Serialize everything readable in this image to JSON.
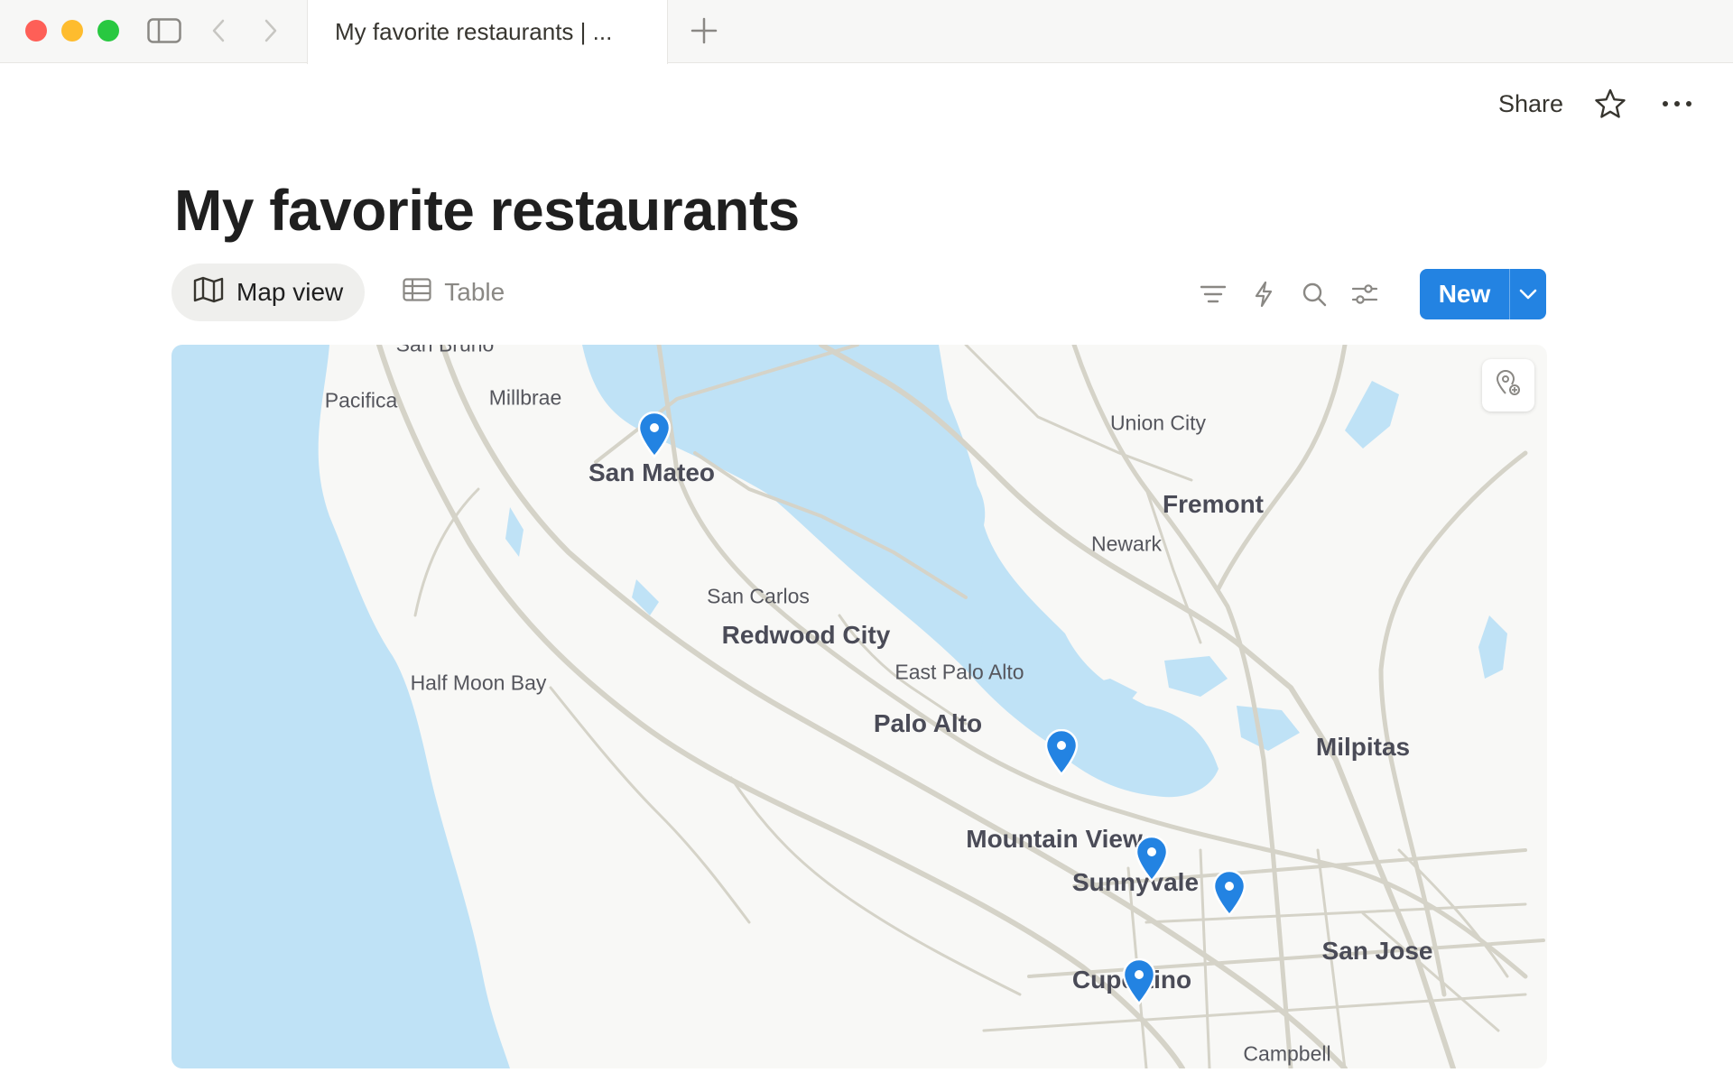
{
  "browser": {
    "tab_title": "My favorite restaurants | ...",
    "icons": [
      "sidebar-icon",
      "back-arrow-icon",
      "forward-arrow-icon",
      "plus-icon"
    ]
  },
  "header": {
    "share_label": "Share",
    "icons": [
      "star-icon",
      "more-icon"
    ]
  },
  "page": {
    "title": "My favorite restaurants"
  },
  "views": [
    {
      "label": "Map view",
      "icon": "map-icon",
      "active": true
    },
    {
      "label": "Table",
      "icon": "table-icon",
      "active": false
    }
  ],
  "toolbar": {
    "icons": [
      "filter-icon",
      "lightning-icon",
      "search-icon",
      "settings-sliders-icon"
    ],
    "new_label": "New",
    "accent": "#2383e2"
  },
  "map": {
    "water_color": "#bfe2f6",
    "land_color": "#f8f8f6",
    "road_color": "#d5d3c8",
    "pin_color": "#2383e2",
    "places": [
      {
        "name": "San Bruno",
        "major": false
      },
      {
        "name": "Pacifica",
        "major": false
      },
      {
        "name": "Millbrae",
        "major": false
      },
      {
        "name": "San Mateo",
        "major": true
      },
      {
        "name": "Union City",
        "major": false
      },
      {
        "name": "Fremont",
        "major": true
      },
      {
        "name": "Newark",
        "major": false
      },
      {
        "name": "San Carlos",
        "major": false
      },
      {
        "name": "Redwood City",
        "major": true
      },
      {
        "name": "East Palo Alto",
        "major": false
      },
      {
        "name": "Half Moon Bay",
        "major": false
      },
      {
        "name": "Palo Alto",
        "major": true
      },
      {
        "name": "Milpitas",
        "major": true
      },
      {
        "name": "Mountain View",
        "major": true
      },
      {
        "name": "Sunnyvale",
        "major": true
      },
      {
        "name": "San Jose",
        "major": true
      },
      {
        "name": "Cupertino",
        "major": true
      },
      {
        "name": "Campbell",
        "major": false
      }
    ],
    "pin_count": 5,
    "location_button_icon": "location-pin-plus-icon"
  }
}
